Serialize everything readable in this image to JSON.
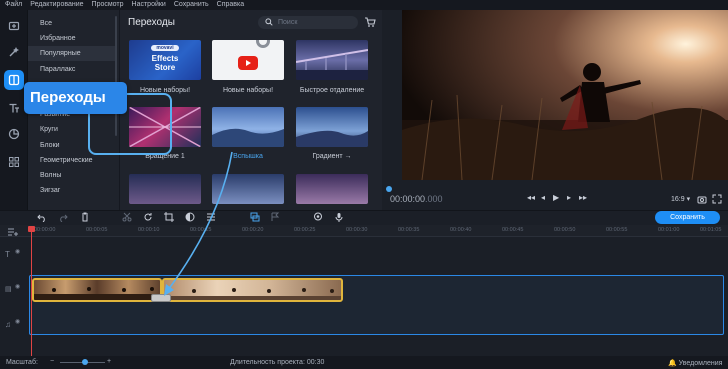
{
  "menu": {
    "items": [
      "Файл",
      "Редактирование",
      "Просмотр",
      "Настройки",
      "Сохранить",
      "Справка"
    ]
  },
  "rail": {
    "tools": [
      {
        "icon": "import-icon"
      },
      {
        "icon": "magic-wand-icon"
      },
      {
        "icon": "transitions-icon",
        "active": true
      },
      {
        "icon": "titles-icon"
      },
      {
        "icon": "stickers-icon"
      },
      {
        "icon": "more-tools-icon"
      }
    ]
  },
  "categories": {
    "items": [
      "Все",
      "Избранное",
      "Популярные",
      "Параллакс",
      "Развитие",
      "Круги",
      "Блоки",
      "Геометрические",
      "Волны",
      "Зигзаг"
    ],
    "active_index": 2
  },
  "callout": {
    "label": "Переходы"
  },
  "panel": {
    "title": "Переходы",
    "search_placeholder": "Поиск",
    "thumbs": [
      {
        "label": "Новые наборы!",
        "store_brand": "movavi",
        "store_line1": "Effects",
        "store_line2": "Store"
      },
      {
        "label": "Новые наборы!"
      },
      {
        "label": "Быстрое отдаление"
      },
      {
        "label": "Вращение 1"
      },
      {
        "label": "Вспышка",
        "selected": true
      },
      {
        "label": "Градиент →"
      }
    ]
  },
  "preview": {
    "timecode": "00:00:00",
    "timecode_ms": ".000",
    "ratio": "16:9 ▾"
  },
  "timeline": {
    "save_label": "Сохранить",
    "ruler": [
      "00:00:00",
      "00:00:05",
      "00:00:10",
      "00:00:15",
      "00:00:20",
      "00:00:25",
      "00:00:30",
      "00:00:35",
      "00:00:40",
      "00:00:45",
      "00:00:50",
      "00:00:55",
      "00:01:00",
      "00:01:05"
    ]
  },
  "status": {
    "zoom_label": "Масштаб:",
    "duration_label": "Длительность проекта:",
    "duration_value": "00:30",
    "notifications": "Уведомления"
  },
  "colors": {
    "accent": "#1e8ef5",
    "clip_border": "#e0b53c",
    "playhead": "#e14444"
  }
}
